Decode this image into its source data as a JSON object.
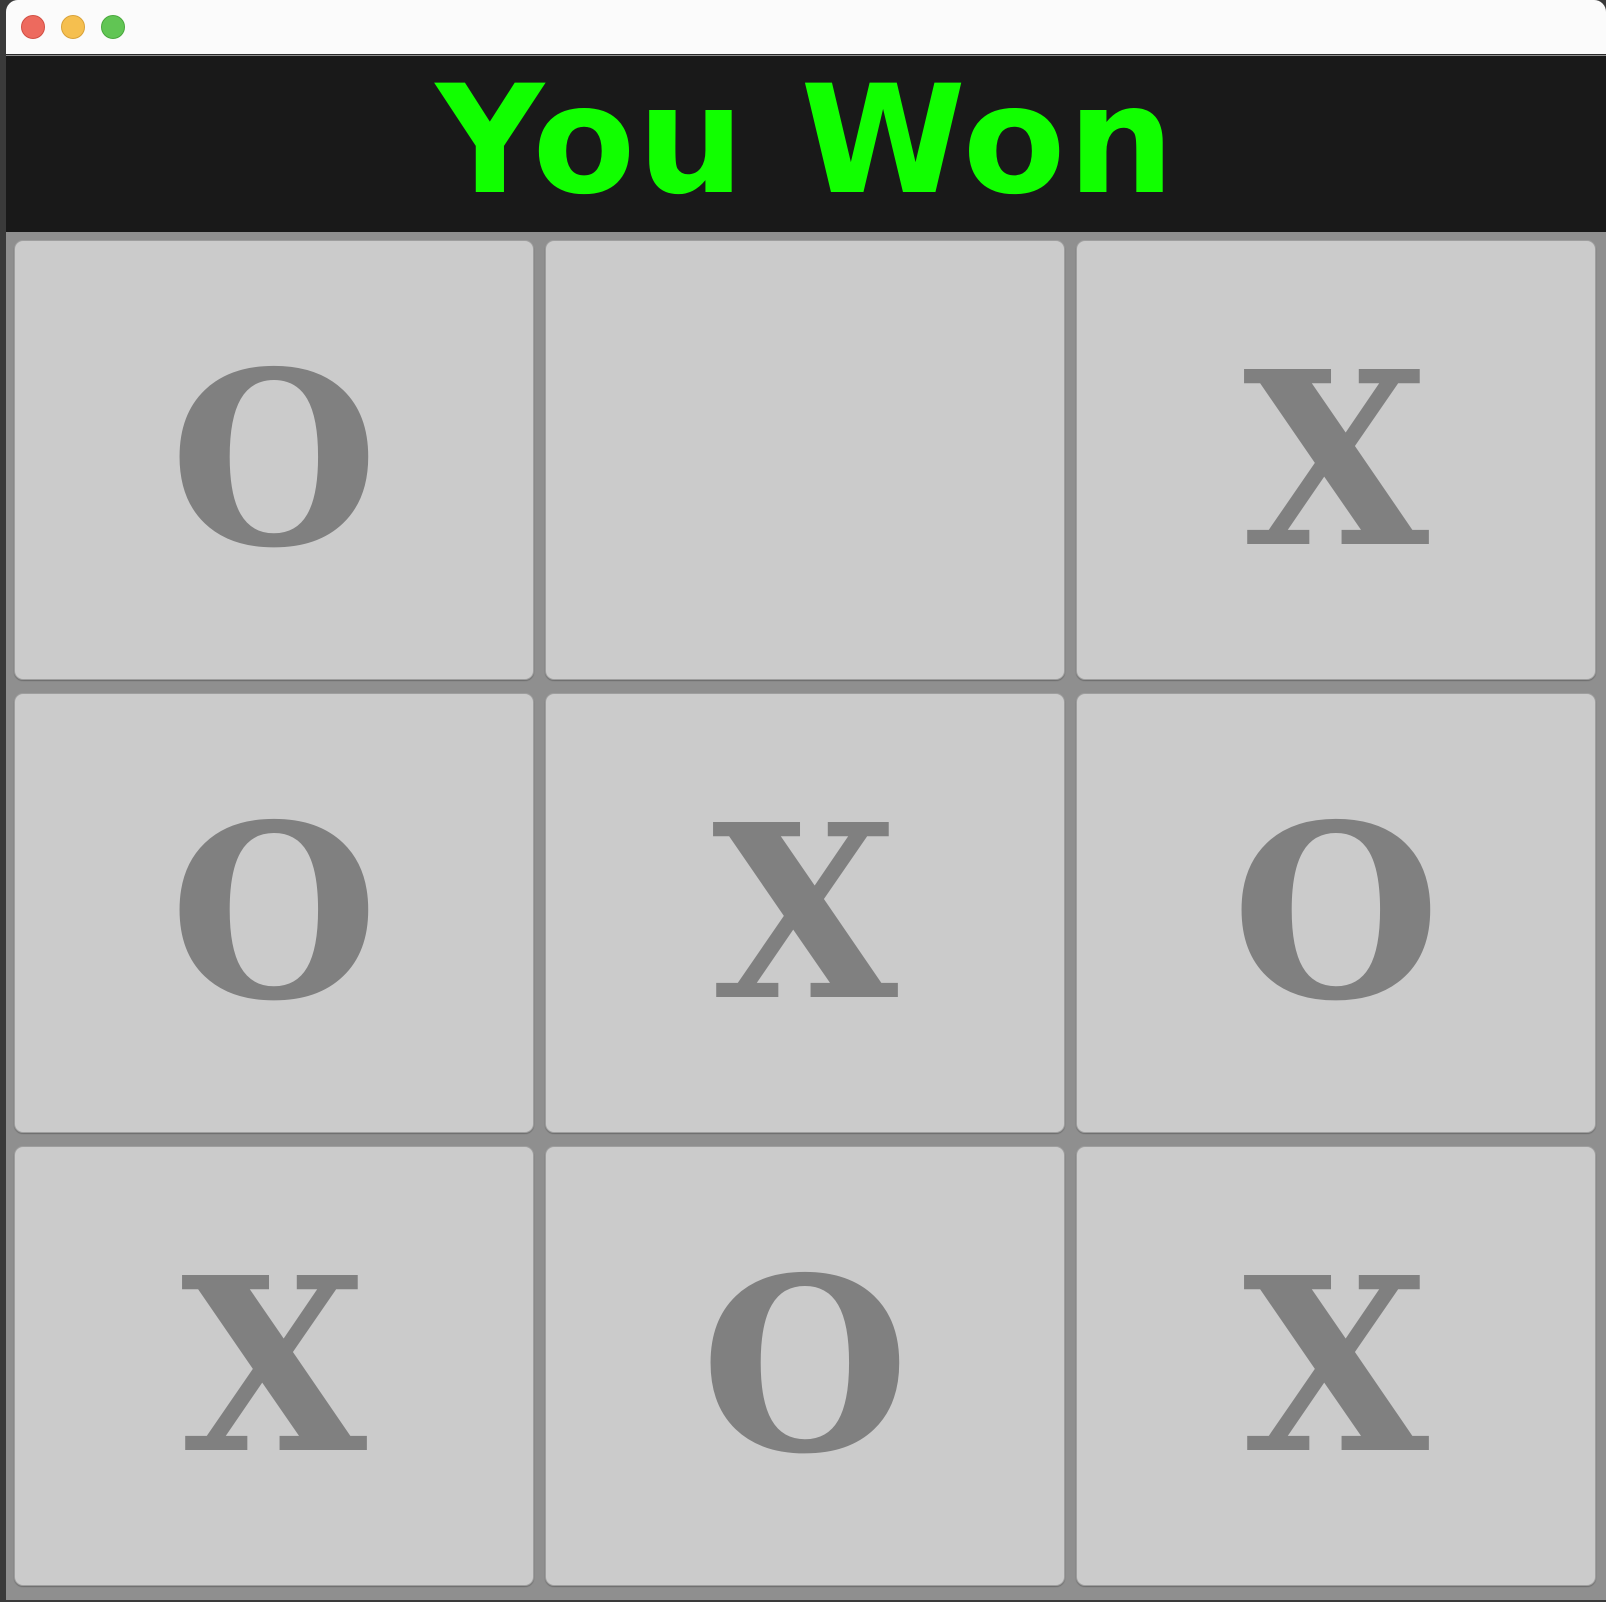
{
  "window": {
    "traffic_lights": [
      "close",
      "minimize",
      "maximize"
    ]
  },
  "banner": {
    "text": "You Won",
    "color": "#11ff00",
    "background": "#191919"
  },
  "board": {
    "cells": [
      {
        "row": 1,
        "col": 1,
        "mark": "O"
      },
      {
        "row": 1,
        "col": 2,
        "mark": ""
      },
      {
        "row": 1,
        "col": 3,
        "mark": "X"
      },
      {
        "row": 2,
        "col": 1,
        "mark": "O"
      },
      {
        "row": 2,
        "col": 2,
        "mark": "X"
      },
      {
        "row": 2,
        "col": 3,
        "mark": "O"
      },
      {
        "row": 3,
        "col": 1,
        "mark": "X"
      },
      {
        "row": 3,
        "col": 2,
        "mark": "O"
      },
      {
        "row": 3,
        "col": 3,
        "mark": "X"
      }
    ],
    "cell_color": "#cbcbcb",
    "mark_color": "#808080"
  }
}
